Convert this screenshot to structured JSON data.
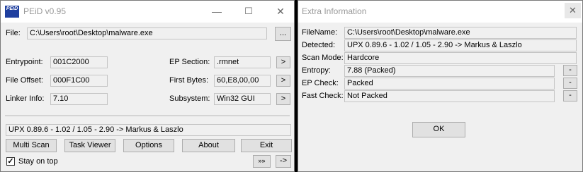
{
  "peid": {
    "title": "PEiD v0.95",
    "icon_text": "PEiD",
    "file_label": "File:",
    "file_path": "C:\\Users\\root\\Desktop\\malware.exe",
    "browse_label": "...",
    "entrypoint_label": "Entrypoint:",
    "entrypoint_value": "001C2000",
    "file_offset_label": "File Offset:",
    "file_offset_value": "000F1C00",
    "linker_info_label": "Linker Info:",
    "linker_info_value": "7.10",
    "ep_section_label": "EP Section:",
    "ep_section_value": ".rmnet",
    "first_bytes_label": "First Bytes:",
    "first_bytes_value": "60,E8,00,00",
    "subsystem_label": "Subsystem:",
    "subsystem_value": "Win32 GUI",
    "more_label": ">",
    "detection": "UPX 0.89.6 - 1.02 / 1.05 - 2.90 -> Markus & Laszlo",
    "buttons": {
      "multi_scan": "Multi Scan",
      "task_viewer": "Task Viewer",
      "options": "Options",
      "about": "About",
      "exit": "Exit"
    },
    "stay_on_top_label": "Stay on top",
    "stay_on_top_checked": true,
    "plugins_button": "»»",
    "extra_button": "->"
  },
  "extra": {
    "title": "Extra Information",
    "filename_label": "FileName:",
    "filename_value": "C:\\Users\\root\\Desktop\\malware.exe",
    "detected_label": "Detected:",
    "detected_value": "UPX 0.89.6 - 1.02 / 1.05 - 2.90 -> Markus & Laszlo",
    "scan_mode_label": "Scan Mode:",
    "scan_mode_value": "Hardcore",
    "entropy_label": "Entropy:",
    "entropy_value": "7.88 (Packed)",
    "ep_check_label": "EP Check:",
    "ep_check_value": "Packed",
    "fast_check_label": "Fast Check:",
    "fast_check_value": "Not Packed",
    "minus_label": "-",
    "ok_label": "OK"
  }
}
